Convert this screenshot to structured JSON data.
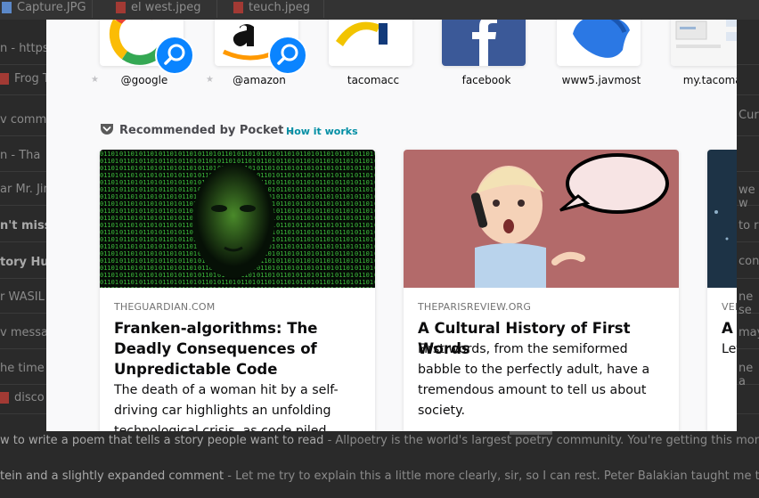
{
  "background": {
    "tabs": [
      {
        "label": "Capture.JPG"
      },
      {
        "label": "el west.jpeg"
      },
      {
        "label": "teuch.jpeg"
      }
    ],
    "rows": [
      {
        "text": "n - https:"
      },
      {
        "text": "Frog T"
      },
      {
        "text": "v comme"
      },
      {
        "text": "n - Tha"
      },
      {
        "text": "ar Mr. Jim"
      },
      {
        "text": "n't miss c"
      },
      {
        "text": "tory Hub"
      },
      {
        "text": "r WASIL"
      },
      {
        "text": "v messa"
      },
      {
        "text": "he time"
      },
      {
        "text": "disco"
      }
    ],
    "right_fragments": [
      "Cur",
      "we w",
      "to r",
      "conter",
      "ne se",
      "may",
      "ne a"
    ],
    "bottom_lines": [
      {
        "bold": "w to write a poem that tells a story people want to read",
        "rest": " - Allpoetry is the world's largest poetry community. You're getting this monthly"
      },
      {
        "bold": "tein and a slightly expanded comment",
        "rest": " - Let me try to explain this a little more clearly, sir, so I can rest. Peter Balakian taught me the w"
      }
    ]
  },
  "top_sites": [
    {
      "label": "@google",
      "pinned": true,
      "icon": "google-icon"
    },
    {
      "label": "@amazon",
      "pinned": true,
      "icon": "amazon-icon"
    },
    {
      "label": "tacomacc",
      "pinned": false,
      "icon": "tacomacc-icon"
    },
    {
      "label": "facebook",
      "pinned": false,
      "icon": "facebook-icon"
    },
    {
      "label": "www5.javmost",
      "pinned": false,
      "icon": "javmost-icon"
    },
    {
      "label": "my.tacomac",
      "pinned": false,
      "icon": "screenshot-thumbnail"
    }
  ],
  "pocket": {
    "heading": "Recommended by Pocket",
    "how_it_works": "How it works",
    "stories": [
      {
        "source": "THEGUARDIAN.COM",
        "title": "Franken-algorithms: The Deadly Consequences of Unpredictable Code",
        "excerpt": "The death of a woman hit by a self-driving car highlights an unfolding technological crisis, as code piled"
      },
      {
        "source": "THEPARISREVIEW.ORG",
        "title": "A Cultural History of First Words",
        "excerpt": "First words, from the semiformed babble to the perfectly adult, have a tremendous amount to tell us about society."
      },
      {
        "source": "VER",
        "title": "A",
        "excerpt": "Let"
      }
    ]
  },
  "colors": {
    "accent": "#0a84ff",
    "link": "#008ea4",
    "panel_bg": "#f9f9fa"
  }
}
